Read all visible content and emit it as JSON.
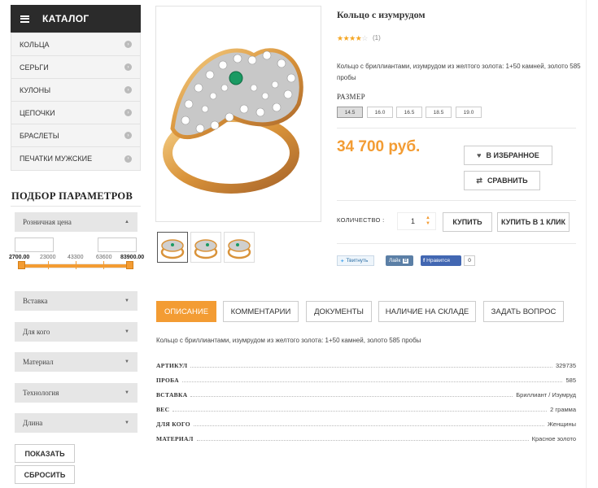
{
  "catalog": {
    "title": "КАТАЛОГ",
    "items": [
      {
        "label": "КОЛЬЦА"
      },
      {
        "label": "СЕРЬГИ"
      },
      {
        "label": "КУЛОНЫ"
      },
      {
        "label": "ЦЕПОЧКИ"
      },
      {
        "label": "БРАСЛЕТЫ"
      },
      {
        "label": "ПЕЧАТКИ МУЖСКИЕ"
      }
    ]
  },
  "filter": {
    "title": "ПОДБОР ПАРАМЕТРОВ",
    "price_label": "Розничная цена",
    "min": "2700.00",
    "max": "83900.00",
    "ticks": [
      "23000",
      "43300",
      "63600"
    ],
    "selects": [
      "Вставка",
      "Для кого",
      "Материал",
      "Технология",
      "Длина"
    ],
    "show_button": "ПОКАЗАТЬ",
    "reset_button": "СБРОСИТЬ"
  },
  "product": {
    "title": "Кольцо с изумрудом",
    "rating_value": 4,
    "rating_max": 5,
    "rating_count": "(1)",
    "description": "Кольцо с бриллиантами, изумрудом из желтого золота: 1+50 камней, золото 585 пробы",
    "size_label": "РАЗМЕР",
    "sizes": [
      "14.5",
      "16.0",
      "16.5",
      "18.5",
      "19.0"
    ],
    "selected_size": "14.5",
    "price": "34 700 руб.",
    "favorite_button": "В ИЗБРАННОЕ",
    "compare_button": "СРАВНИТЬ",
    "quantity_label": "КОЛИЧЕСТВО :",
    "quantity": "1",
    "buy_button": "КУПИТЬ",
    "buy_one_click_button": "КУПИТЬ В 1 КЛИК"
  },
  "social": {
    "twitter": "Твитнуть",
    "vk": "Лайк",
    "facebook": "Нравится",
    "fb_count": "0"
  },
  "tabs": [
    "ОПИСАНИЕ",
    "КОММЕНТАРИИ",
    "ДОКУМЕНТЫ",
    "НАЛИЧИЕ НА СКЛАДЕ",
    "ЗАДАТЬ ВОПРОС"
  ],
  "tab_description": "Кольцо с бриллиантами, изумрудом из желтого золота: 1+50 камней, золото 585 пробы",
  "specs": [
    {
      "key": "АРТИКУЛ",
      "value": "329735"
    },
    {
      "key": "ПРОБА",
      "value": "585"
    },
    {
      "key": "ВСТАВКА",
      "value": "Бриллиант / Изумруд"
    },
    {
      "key": "ВЕС",
      "value": "2 грамма"
    },
    {
      "key": "ДЛЯ КОГО",
      "value": "Женщины"
    },
    {
      "key": "МАТЕРИАЛ",
      "value": "Красное золото"
    }
  ],
  "colors": {
    "accent": "#f39c33",
    "header_dark": "#2b2b2b",
    "star": "#f5a623"
  }
}
